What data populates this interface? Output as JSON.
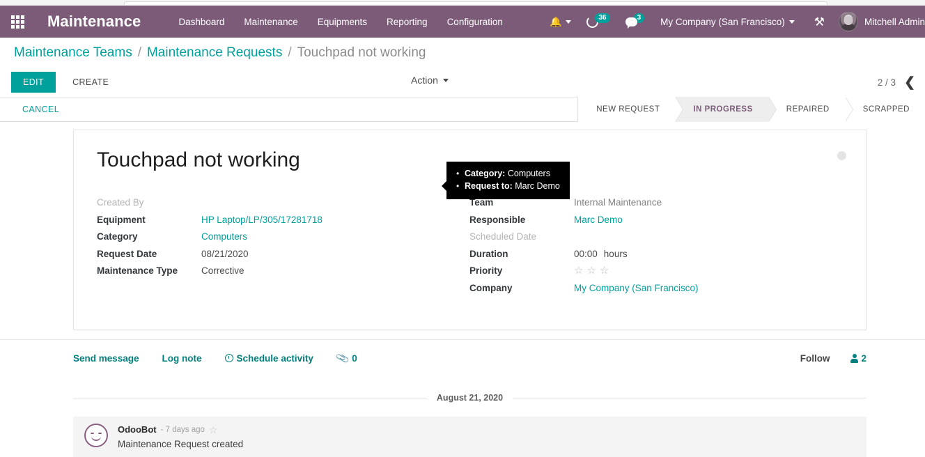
{
  "navbar": {
    "apps_icon": "apps-grid-icon",
    "app_title": "Maintenance",
    "menu": [
      {
        "label": "Dashboard"
      },
      {
        "label": "Maintenance"
      },
      {
        "label": "Equipments"
      },
      {
        "label": "Reporting"
      },
      {
        "label": "Configuration"
      }
    ],
    "bell_icon": "bell-icon",
    "activities_icon": "activity-clock-icon",
    "activities_count": "36",
    "messages_icon": "chat-bubble-icon",
    "messages_count": "3",
    "company": "My Company (San Francisco)",
    "tools_icon": "tools-wrench-icon",
    "user_name": "Mitchell Admin"
  },
  "breadcrumb": {
    "items": [
      {
        "label": "Maintenance Teams",
        "link": true
      },
      {
        "label": "Maintenance Requests",
        "link": true
      },
      {
        "label": "Touchpad not working",
        "link": false
      }
    ],
    "separator": "/"
  },
  "control_panel": {
    "edit_label": "EDIT",
    "create_label": "CREATE",
    "action_label": "Action",
    "pager": "2 / 3",
    "prev_icon": "chevron-left-icon"
  },
  "statusbar": {
    "cancel_label": "CANCEL",
    "stages": [
      {
        "label": "NEW REQUEST",
        "active": false
      },
      {
        "label": "IN PROGRESS",
        "active": true
      },
      {
        "label": "REPAIRED",
        "active": false
      },
      {
        "label": "SCRAPPED",
        "active": false
      }
    ]
  },
  "form": {
    "title": "Touchpad not working",
    "state_dot": "kanban-state-indicator",
    "left_fields": [
      {
        "label": "Created By",
        "value": "",
        "style": "muted"
      },
      {
        "label": "Equipment",
        "value": "HP Laptop/LP/305/17281718",
        "style": "link"
      },
      {
        "label": "Category",
        "value": "Computers",
        "style": "link"
      },
      {
        "label": "Request Date",
        "value": "08/21/2020",
        "style": "text"
      },
      {
        "label": "Maintenance Type",
        "value": "Corrective",
        "style": "text"
      }
    ],
    "right_fields": [
      {
        "label": "Team",
        "value": "Internal Maintenance",
        "style": "gray"
      },
      {
        "label": "Responsible",
        "value": "Marc Demo",
        "style": "link"
      },
      {
        "label": "Scheduled Date",
        "value": "",
        "style": "muted"
      },
      {
        "label": "Duration",
        "value": "00:00",
        "style": "duration",
        "unit": "hours"
      },
      {
        "label": "Priority",
        "value": "",
        "style": "stars",
        "stars_total": 3,
        "stars_filled": 0
      },
      {
        "label": "Company",
        "value": "My Company (San Francisco)",
        "style": "link"
      }
    ]
  },
  "tooltip": {
    "lines": [
      {
        "label": "Category:",
        "value": "Computers"
      },
      {
        "label": "Request to:",
        "value": "Marc Demo"
      }
    ]
  },
  "chatter": {
    "send_message": "Send message",
    "log_note": "Log note",
    "schedule_activity": "Schedule activity",
    "schedule_icon": "clock-icon",
    "attachment_icon": "paperclip-icon",
    "attachment_count": "0",
    "follow_label": "Follow",
    "followers_icon": "person-icon",
    "followers_count": "2",
    "date_separator": "August 21, 2020",
    "messages": [
      {
        "author": "OdooBot",
        "time": "- 7 days ago",
        "star_icon": "star-outline-icon",
        "body": "Maintenance Request created"
      }
    ]
  },
  "colors": {
    "navbar_purple": "#7c5b79",
    "accent_teal": "#00a09d",
    "stage_active_text": "#7c5b79"
  }
}
